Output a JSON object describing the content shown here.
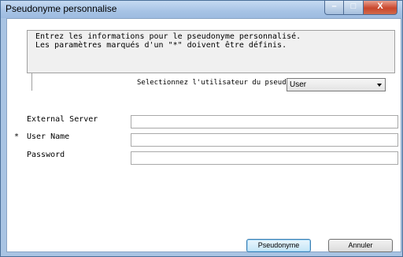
{
  "window": {
    "title": "Pseudonyme personnalise"
  },
  "controls": {
    "minimize": "–",
    "maximize": "□",
    "close": "X"
  },
  "info": {
    "line1": "Entrez les informations pour le pseudonyme personnalisé.",
    "line2": "Les paramètres marqués d'un \"*\" doivent être définis."
  },
  "user_select": {
    "label": "Selectionnez l'utilisateur du pseudonyme",
    "value": "User"
  },
  "fields": [
    {
      "label": "External Server",
      "required": false,
      "value": ""
    },
    {
      "label": "User Name",
      "required": true,
      "required_marker": "*",
      "value": ""
    },
    {
      "label": "Password",
      "required": false,
      "value": ""
    }
  ],
  "buttons": {
    "ok": "Pseudonyme",
    "cancel": "Annuler"
  }
}
